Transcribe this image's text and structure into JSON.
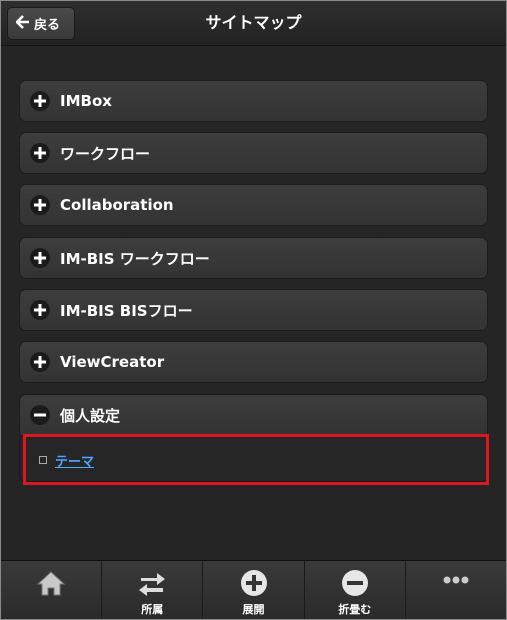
{
  "header": {
    "back_label": "戻る",
    "title": "サイトマップ"
  },
  "sitemap": {
    "items": [
      {
        "label": "IMBox",
        "state": "collapsed"
      },
      {
        "label": "ワークフロー",
        "state": "collapsed"
      },
      {
        "label": "Collaboration",
        "state": "collapsed"
      },
      {
        "label": "IM-BIS ワークフロー",
        "state": "collapsed"
      },
      {
        "label": "IM-BIS BISフロー",
        "state": "collapsed"
      },
      {
        "label": "ViewCreator",
        "state": "collapsed"
      },
      {
        "label": "個人設定",
        "state": "expanded"
      }
    ],
    "expanded_children": [
      {
        "label": "テーマ"
      }
    ]
  },
  "footer": {
    "buttons": [
      {
        "icon": "home-icon",
        "label": ""
      },
      {
        "icon": "swap-icon",
        "label": "所属"
      },
      {
        "icon": "plus-circle-icon",
        "label": "展開"
      },
      {
        "icon": "minus-circle-icon",
        "label": "折畳む"
      },
      {
        "icon": "more-icon",
        "label": ""
      }
    ]
  },
  "colors": {
    "background": "#252525",
    "link": "#4fa8ff",
    "highlight": "#e0151f"
  }
}
